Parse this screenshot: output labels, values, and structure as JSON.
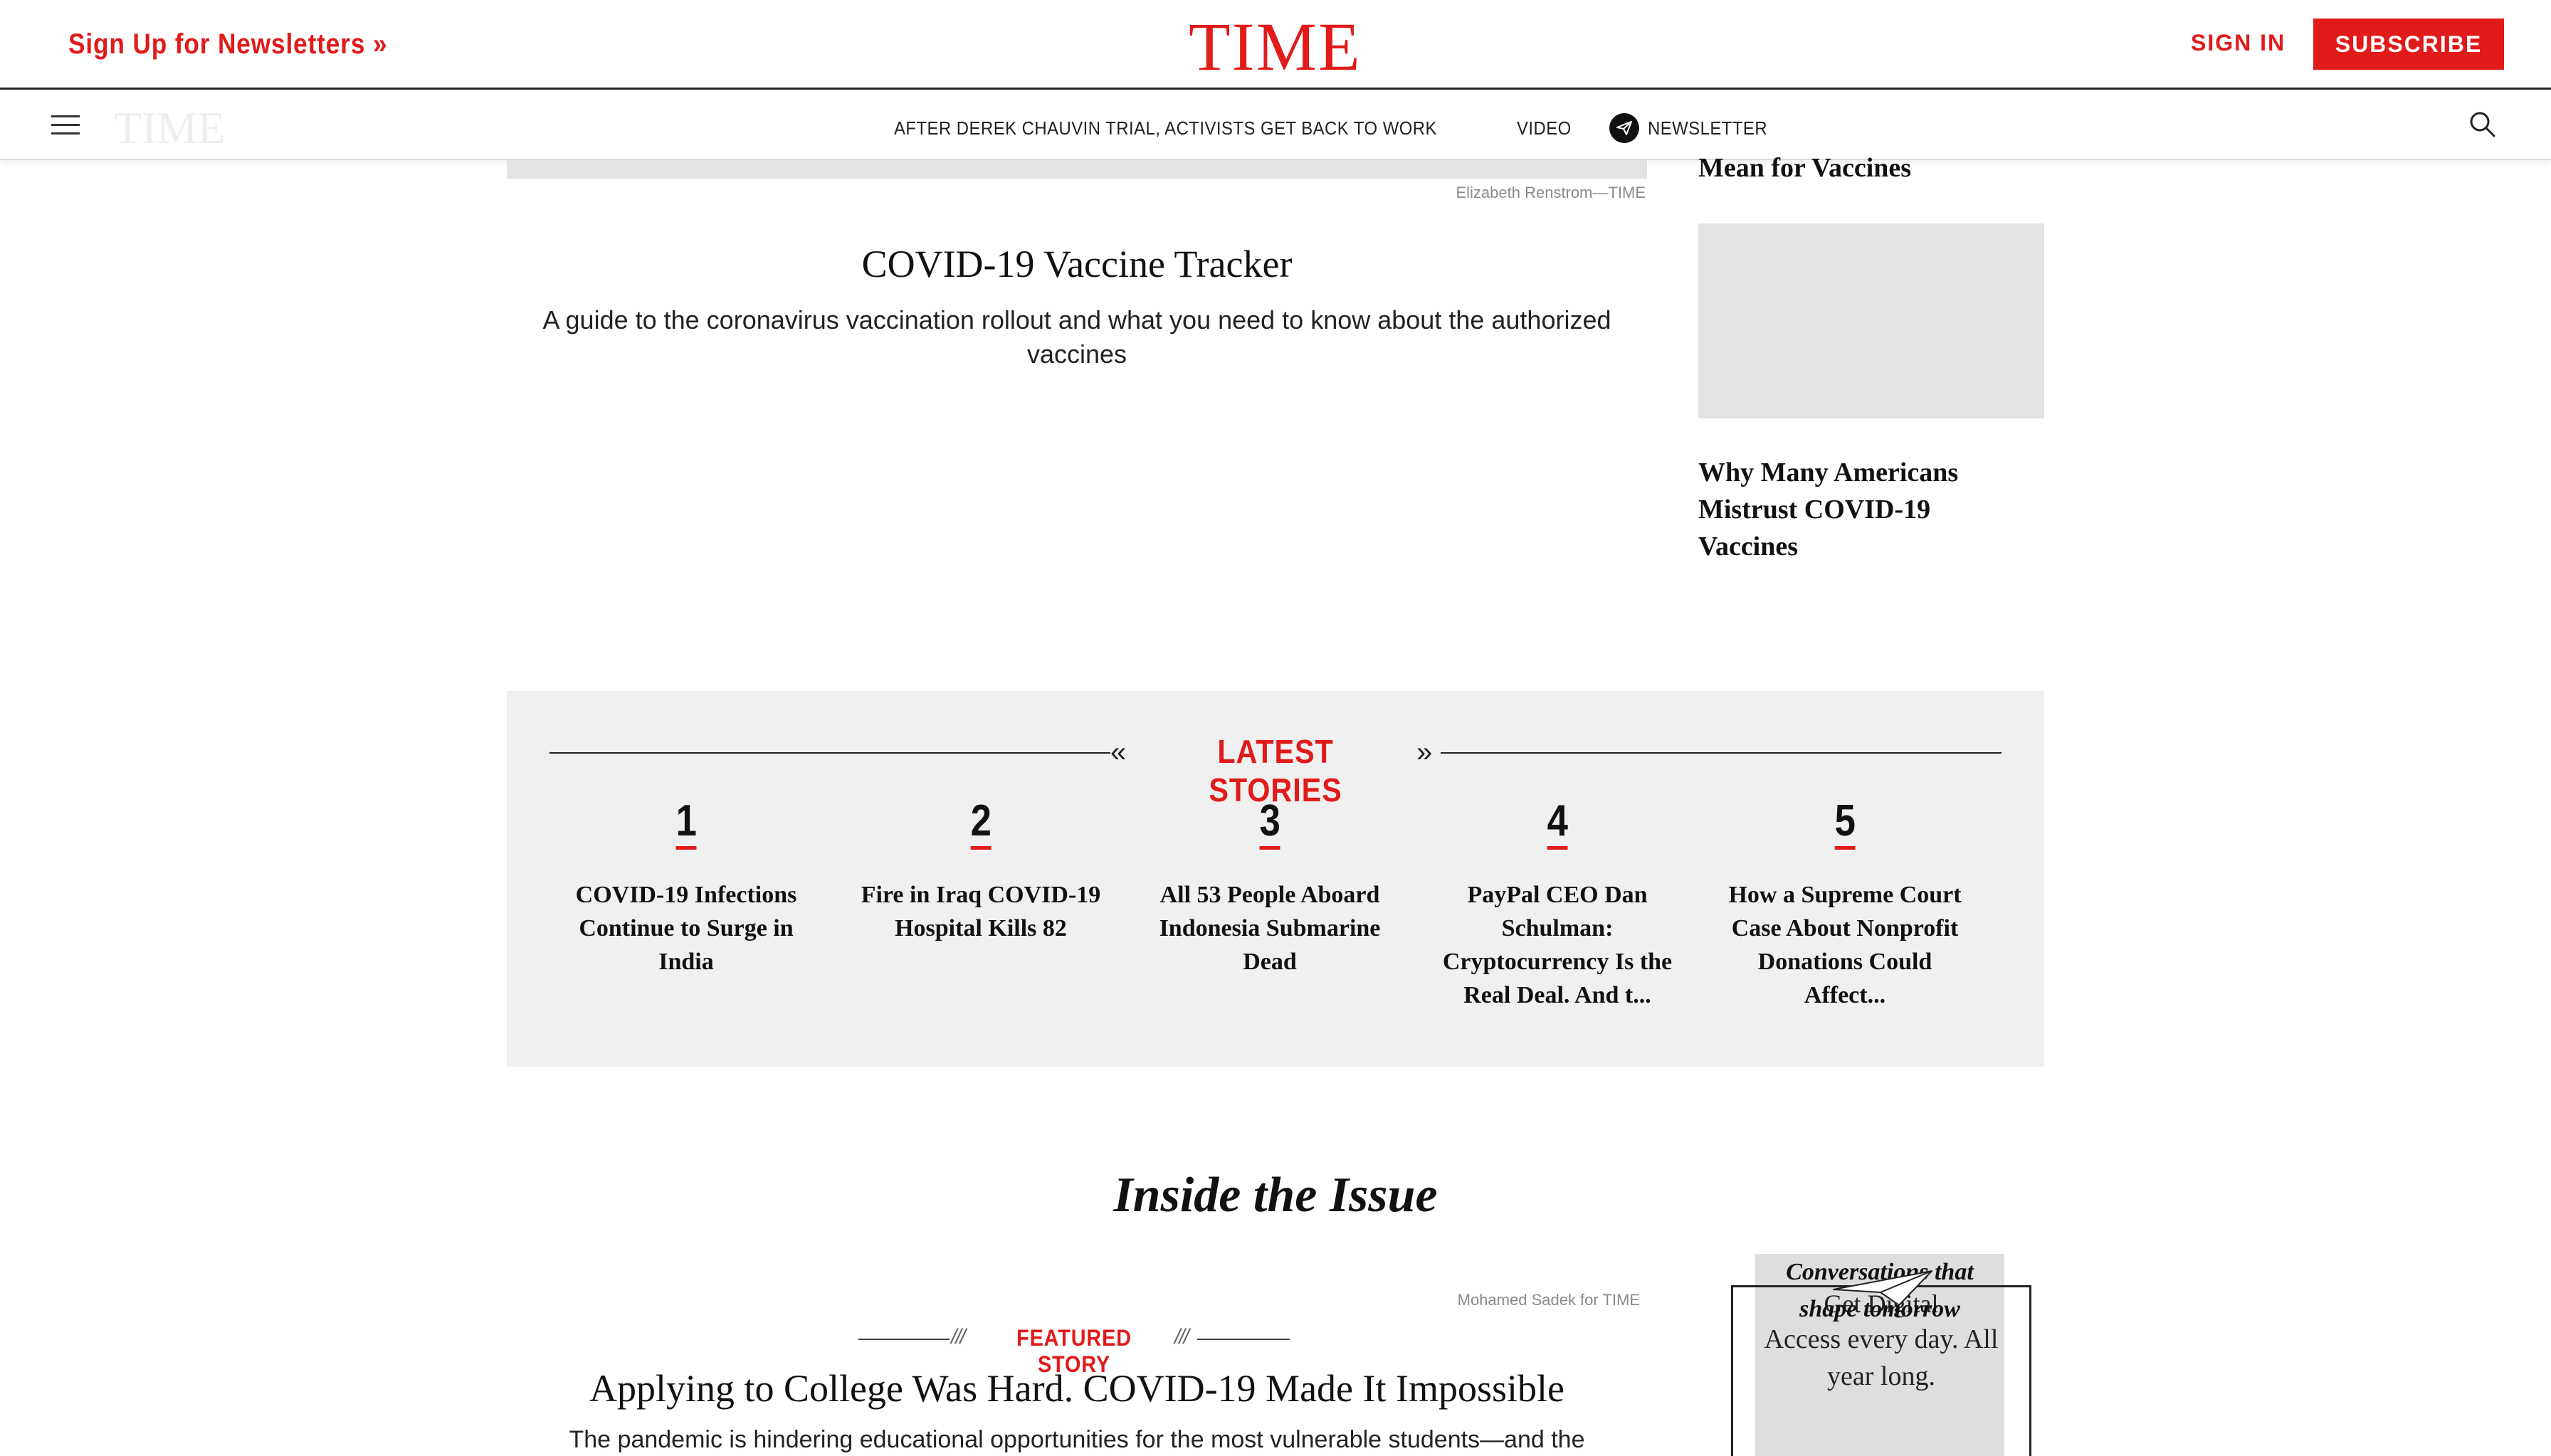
{
  "header": {
    "newsletter_link": "Sign Up for Newsletters »",
    "logo": "TIME",
    "signin": "SIGN IN",
    "subscribe": "SUBSCRIBE"
  },
  "nav": {
    "ghost_logo": "TIME",
    "items": [
      "AFTER DEREK CHAUVIN TRIAL, ACTIVISTS GET BACK TO WORK",
      "VIDEO"
    ],
    "newsletter": "NEWSLETTER"
  },
  "main": {
    "top_image_credit": "Elizabeth Renstrom—TIME",
    "tracker_title": "COVID-19 Vaccine Tracker",
    "tracker_desc": "A guide to the coronavirus vaccination rollout and what you need to know about the authorized vaccines"
  },
  "sidebar": {
    "partial_headline": "Mean for Vaccines",
    "headline_2": "Why Many Americans Mistrust COVID-19 Vaccines"
  },
  "latest": {
    "title": "LATEST STORIES",
    "stories": [
      {
        "num": "1",
        "headline": "COVID-19 Infections Continue to Surge in India"
      },
      {
        "num": "2",
        "headline": "Fire in Iraq COVID-19 Hospital Kills 82"
      },
      {
        "num": "3",
        "headline": "All 53 People Aboard Indonesia Submarine Dead"
      },
      {
        "num": "4",
        "headline": "PayPal CEO Dan Schulman: Cryptocurrency Is the Real Deal. And t..."
      },
      {
        "num": "5",
        "headline": "How a Supreme Court Case About Nonprofit Donations Could Affect..."
      }
    ]
  },
  "issue": {
    "title": "Inside the Issue",
    "image_credit": "Mohamed Sadek for TIME",
    "featured_label": "FEATURED STORY",
    "featured_headline": "Applying to College Was Hard. COVID-19 Made It Impossible",
    "featured_desc": "The pandemic is hindering educational opportunities for the most vulnerable students—and the"
  },
  "promo": {
    "headline": "Conversations that shape tomorrow",
    "digital": "Get Digital",
    "text": "Access every day. All year long."
  },
  "colors": {
    "brand_red": "#e11a1a",
    "panel_gray": "#f0f0f0",
    "placeholder_gray": "#e3e3e1"
  }
}
